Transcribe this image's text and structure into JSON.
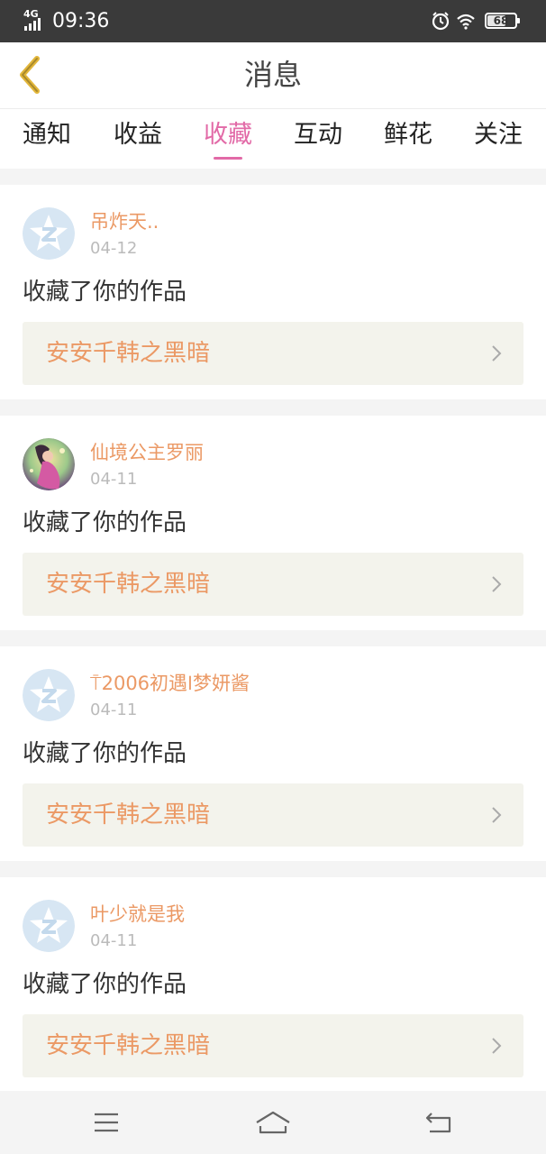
{
  "status_bar": {
    "network": "4G",
    "time": "09:36",
    "battery": "68",
    "battery_level": 0.68
  },
  "header": {
    "title": "消息"
  },
  "tabs": [
    {
      "label": "通知",
      "active": false
    },
    {
      "label": "收益",
      "active": false
    },
    {
      "label": "收藏",
      "active": true
    },
    {
      "label": "互动",
      "active": false
    },
    {
      "label": "鲜花",
      "active": false
    },
    {
      "label": "关注",
      "active": false
    }
  ],
  "messages": [
    {
      "username": "吊炸天..",
      "date": "04-12",
      "action": "收藏了你的作品",
      "work_title": "安安千韩之黑暗",
      "avatar": "default-qq-avatar"
    },
    {
      "username": "仙境公主罗丽",
      "date": "04-11",
      "action": "收藏了你的作品",
      "work_title": "安安千韩之黑暗",
      "avatar": "fairy-avatar"
    },
    {
      "username": "⍑2006初遇𐌉梦妍酱",
      "date": "04-11",
      "action": "收藏了你的作品",
      "work_title": "安安千韩之黑暗",
      "avatar": "default-qq-avatar"
    },
    {
      "username": "叶少就是我",
      "date": "04-11",
      "action": "收藏了你的作品",
      "work_title": "安安千韩之黑暗",
      "avatar": "default-qq-avatar"
    }
  ],
  "colors": {
    "accent": "#e26aa7",
    "username": "#eb9965",
    "back_arrow": "#e2b63a"
  }
}
